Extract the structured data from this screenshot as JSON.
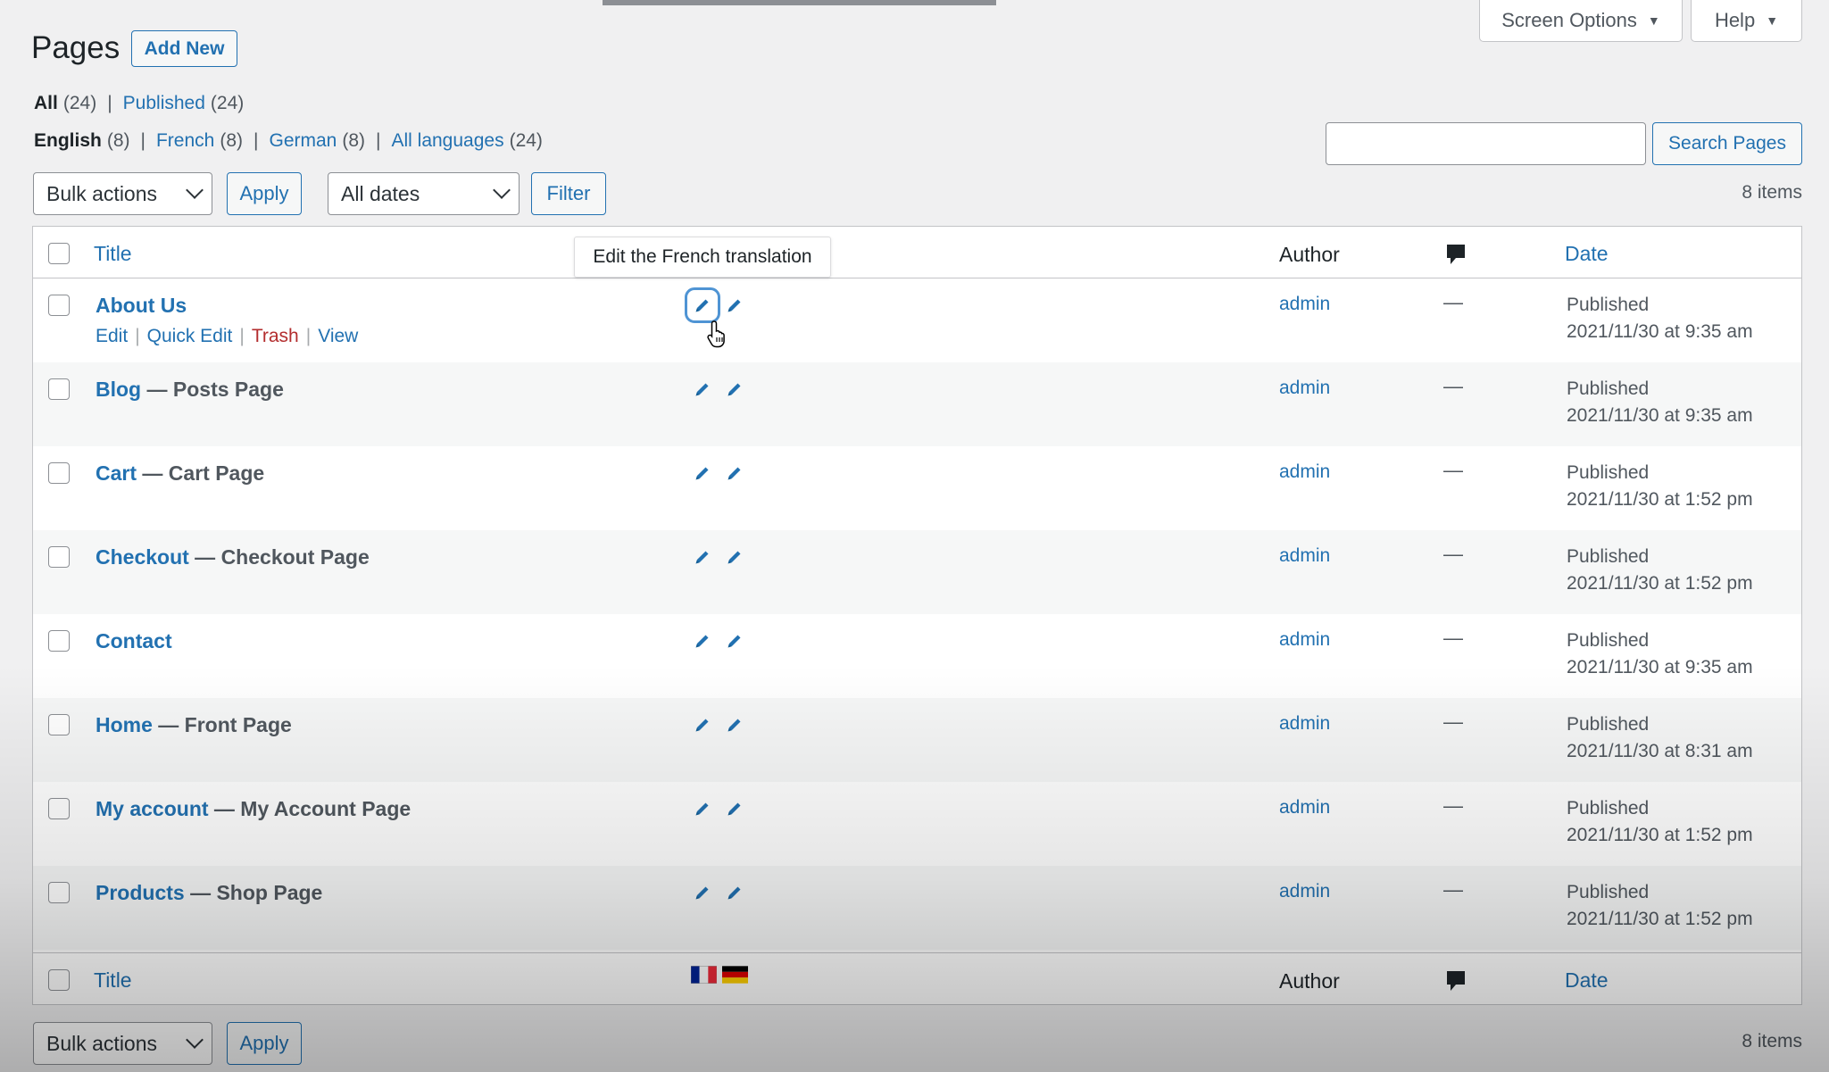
{
  "header": {
    "title": "Pages",
    "add_new": "Add New",
    "screen_options": "Screen Options",
    "help": "Help",
    "dropdown_glyph": "▼"
  },
  "filters": {
    "status": [
      {
        "label": "All",
        "count": "(24)",
        "current": true
      },
      {
        "label": "Published",
        "count": "(24)",
        "current": false
      }
    ],
    "languages": [
      {
        "label": "English",
        "count": "(8)",
        "current": true
      },
      {
        "label": "French",
        "count": "(8)",
        "current": false
      },
      {
        "label": "German",
        "count": "(8)",
        "current": false
      },
      {
        "label": "All languages",
        "count": "(24)",
        "current": false
      }
    ],
    "separator": "|"
  },
  "search": {
    "placeholder": "",
    "button": "Search Pages"
  },
  "toolbar_top": {
    "bulk_actions": "Bulk actions",
    "apply": "Apply",
    "dates": "All dates",
    "filter": "Filter",
    "items": "8 items"
  },
  "toolbar_bottom": {
    "bulk_actions": "Bulk actions",
    "apply": "Apply",
    "items": "8 items"
  },
  "table": {
    "columns": {
      "title": "Title",
      "author": "Author",
      "date": "Date"
    },
    "tooltip": "Edit the French translation",
    "row_actions": {
      "edit": "Edit",
      "quick_edit": "Quick Edit",
      "trash": "Trash",
      "view": "View"
    },
    "rows": [
      {
        "title": "About Us",
        "state": "",
        "author": "admin",
        "comments": "—",
        "status": "Published",
        "date": "2021/11/30 at 9:35 am"
      },
      {
        "title": "Blog",
        "state": " — Posts Page",
        "author": "admin",
        "comments": "—",
        "status": "Published",
        "date": "2021/11/30 at 9:35 am"
      },
      {
        "title": "Cart",
        "state": " — Cart Page",
        "author": "admin",
        "comments": "—",
        "status": "Published",
        "date": "2021/11/30 at 1:52 pm"
      },
      {
        "title": "Checkout",
        "state": " — Checkout Page",
        "author": "admin",
        "comments": "—",
        "status": "Published",
        "date": "2021/11/30 at 1:52 pm"
      },
      {
        "title": "Contact",
        "state": "",
        "author": "admin",
        "comments": "—",
        "status": "Published",
        "date": "2021/11/30 at 9:35 am"
      },
      {
        "title": "Home",
        "state": " — Front Page",
        "author": "admin",
        "comments": "—",
        "status": "Published",
        "date": "2021/11/30 at 8:31 am"
      },
      {
        "title": "My account",
        "state": " — My Account Page",
        "author": "admin",
        "comments": "—",
        "status": "Published",
        "date": "2021/11/30 at 1:52 pm"
      },
      {
        "title": "Products",
        "state": " — Shop Page",
        "author": "admin",
        "comments": "—",
        "status": "Published",
        "date": "2021/11/30 at 1:52 pm"
      }
    ]
  },
  "colors": {
    "link": "#2271b1",
    "trash": "#b32d2e",
    "background": "#f0f0f1"
  },
  "icons": {
    "comment": "comment-bubble-icon",
    "edit_translation": "pencil-icon",
    "flag_fr": "flag-france-icon",
    "flag_de": "flag-germany-icon"
  }
}
